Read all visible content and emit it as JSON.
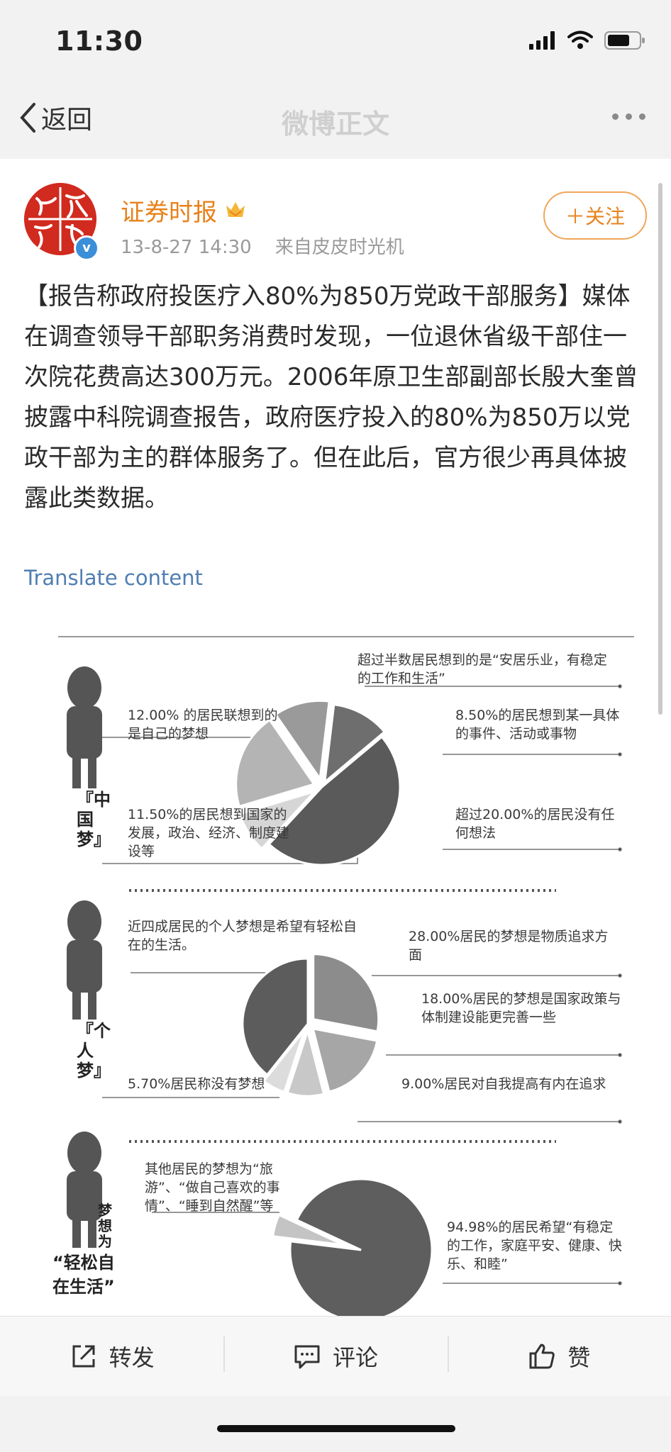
{
  "status_bar": {
    "time": "11:30"
  },
  "nav": {
    "back_label": "返回",
    "title": "微博正文"
  },
  "post": {
    "author": "证券时报",
    "timestamp": "13-8-27 14:30",
    "source": "来自皮皮时光机",
    "follow_label": "＋关注",
    "text": "【报告称政府投医疗入80%为850万党政干部服务】媒体在调查领导干部职务消费时发现，一位退休省级干部住一次院花费高达300万元。2006年原卫生部副部长殷大奎曾披露中科院调查报告，政府医疗投入的80%为850万以党政干部为主的群体服务了。但在此后，官方很少再具体披露此类数据。",
    "translate_label": "Translate content"
  },
  "infographic": {
    "section1": {
      "label": "『中国梦』",
      "note_top": "超过半数居民想到的是“安居乐业，有稳定的工作和生活”",
      "note_12": "12.00% 的居民联想到的是自己的梦想",
      "note_8_5": "8.50%的居民想到某一具体的事件、活动或事物",
      "note_11_5": "11.50%的居民想到国家的发展，政治、经济、制度建设等",
      "note_20": "超过20.00%的居民没有任何想法"
    },
    "section2": {
      "label": "『个人梦』",
      "note_40": "近四成居民的个人梦想是希望有轻松自在的生活。",
      "note_28": "28.00%居民的梦想是物质追求方面",
      "note_18": "18.00%居民的梦想是国家政策与体制建设能更完善一些",
      "note_5_7": "5.70%居民称没有梦想",
      "note_9": "9.00%居民对自我提高有内在追求"
    },
    "section3": {
      "label_small": "梦想为",
      "label_big": "“轻松自在生活”",
      "note_other": "其他居民的梦想为“旅游”、“做自己喜欢的事情”、“睡到自然醒”等",
      "note_94": "94.98%的居民希望“有稳定的工作，家庭平安、健康、快乐、和睦”"
    }
  },
  "chart_data": [
    {
      "type": "pie",
      "name": "中国梦",
      "values": [
        48.0,
        8.5,
        20.0,
        11.5,
        12.0
      ]
    },
    {
      "type": "pie",
      "name": "个人梦",
      "values": [
        28.0,
        18.0,
        9.0,
        5.7,
        39.3
      ]
    },
    {
      "type": "pie",
      "name": "轻松自在生活",
      "values": [
        94.98,
        5.02
      ]
    }
  ],
  "toolbar": {
    "repost": "转发",
    "comment": "评论",
    "like": "赞"
  },
  "colors": {
    "accent": "#e8821b",
    "link": "#4f7eb3",
    "verified": "#3b8ed8"
  }
}
